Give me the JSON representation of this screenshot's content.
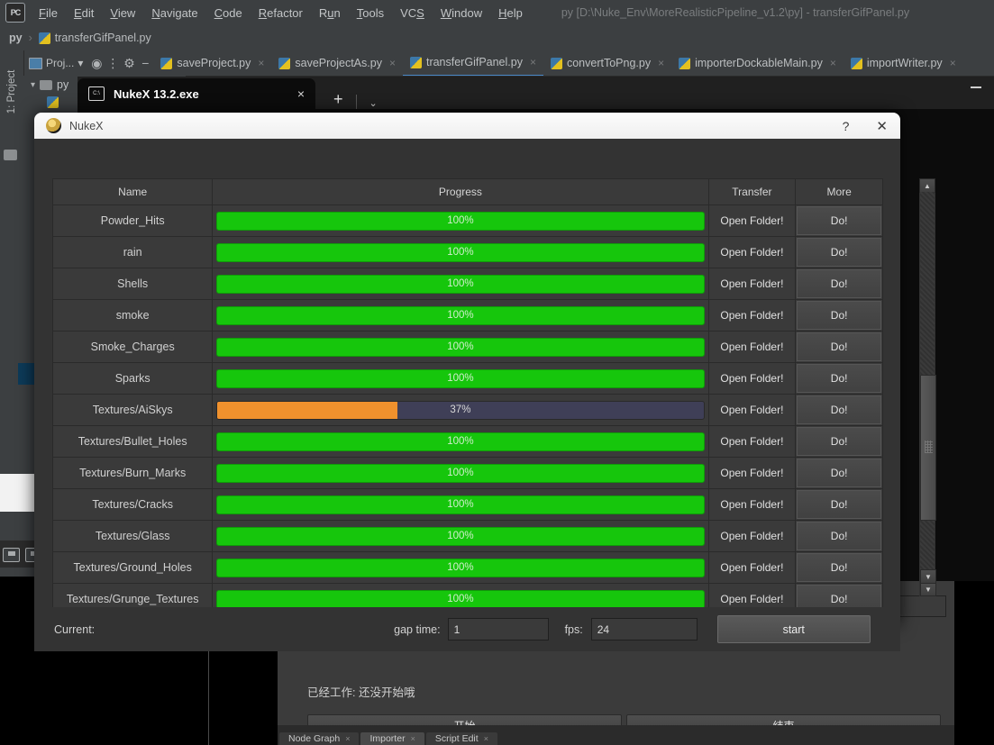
{
  "ide": {
    "window_title": "py [D:\\Nuke_Env\\MoreRealisticPipeline_v1.2\\py] - transferGifPanel.py",
    "logo": "PC",
    "menus": [
      "File",
      "Edit",
      "View",
      "Navigate",
      "Code",
      "Refactor",
      "Run",
      "Tools",
      "VCS",
      "Window",
      "Help"
    ],
    "breadcrumb": {
      "root": "py",
      "sep": "›",
      "file": "transferGifPanel.py"
    },
    "toolbar": {
      "project_selector": "Proj...",
      "chevron": "▾",
      "icons": [
        "target-icon",
        "collapse-icon",
        "settings-icon",
        "minimize-icon"
      ]
    },
    "file_tabs": [
      {
        "label": "saveProject.py",
        "active": false
      },
      {
        "label": "saveProjectAs.py",
        "active": false
      },
      {
        "label": "transferGifPanel.py",
        "active": true
      },
      {
        "label": "convertToPng.py",
        "active": false
      },
      {
        "label": "importerDockableMain.py",
        "active": false
      },
      {
        "label": "importWriter.py",
        "active": false
      }
    ],
    "tab_close": "×",
    "sidebar": {
      "label": "1: Project"
    },
    "project_tree": {
      "root": "py"
    }
  },
  "terminal": {
    "tab_title": "NukeX 13.2.exe",
    "close": "×",
    "new_tab": "+",
    "dropdown": "⌄",
    "minimize": "minimize-icon"
  },
  "dialog": {
    "title": "NukeX",
    "help_glyph": "?",
    "close_glyph": "✕",
    "columns": [
      "Name",
      "Progress",
      "Transfer",
      "More"
    ],
    "transfer_label": "Open Folder!",
    "more_label": "Do!",
    "colors": {
      "complete": "#16c60c",
      "partial": "#f0912d",
      "track": "#3f3f57",
      "panel": "#333333",
      "row": "#3a3a3a"
    },
    "rows": [
      {
        "name": "Powder_Hits",
        "percent": 100,
        "percent_text": "100%"
      },
      {
        "name": "rain",
        "percent": 100,
        "percent_text": "100%"
      },
      {
        "name": "Shells",
        "percent": 100,
        "percent_text": "100%"
      },
      {
        "name": "smoke",
        "percent": 100,
        "percent_text": "100%"
      },
      {
        "name": "Smoke_Charges",
        "percent": 100,
        "percent_text": "100%"
      },
      {
        "name": "Sparks",
        "percent": 100,
        "percent_text": "100%"
      },
      {
        "name": "Textures/AiSkys",
        "percent": 37,
        "percent_text": "37%"
      },
      {
        "name": "Textures/Bullet_Holes",
        "percent": 100,
        "percent_text": "100%"
      },
      {
        "name": "Textures/Burn_Marks",
        "percent": 100,
        "percent_text": "100%"
      },
      {
        "name": "Textures/Cracks",
        "percent": 100,
        "percent_text": "100%"
      },
      {
        "name": "Textures/Glass",
        "percent": 100,
        "percent_text": "100%"
      },
      {
        "name": "Textures/Ground_Holes",
        "percent": 100,
        "percent_text": "100%"
      },
      {
        "name": "Textures/Grunge_Textures",
        "percent": 100,
        "percent_text": "100%"
      }
    ],
    "footer": {
      "current_label": "Current:",
      "current_value": "",
      "gap_time_label": "gap time:",
      "gap_time_value": "1",
      "fps_label": "fps:",
      "fps_value": "24",
      "start_label": "start"
    },
    "scroll": {
      "up": "▲",
      "down": "▼"
    }
  },
  "nuke_panel": {
    "maximize_glyph": "□",
    "close_glyph": "✕",
    "status_text": "已经工作: 还没开始哦",
    "start_button": "开始",
    "end_button": "结束",
    "tabs": [
      {
        "label": "Node Graph",
        "selected": false,
        "close": "×"
      },
      {
        "label": "Importer",
        "selected": true,
        "close": "×"
      },
      {
        "label": "Script Edit",
        "selected": false,
        "close": "×"
      }
    ]
  }
}
